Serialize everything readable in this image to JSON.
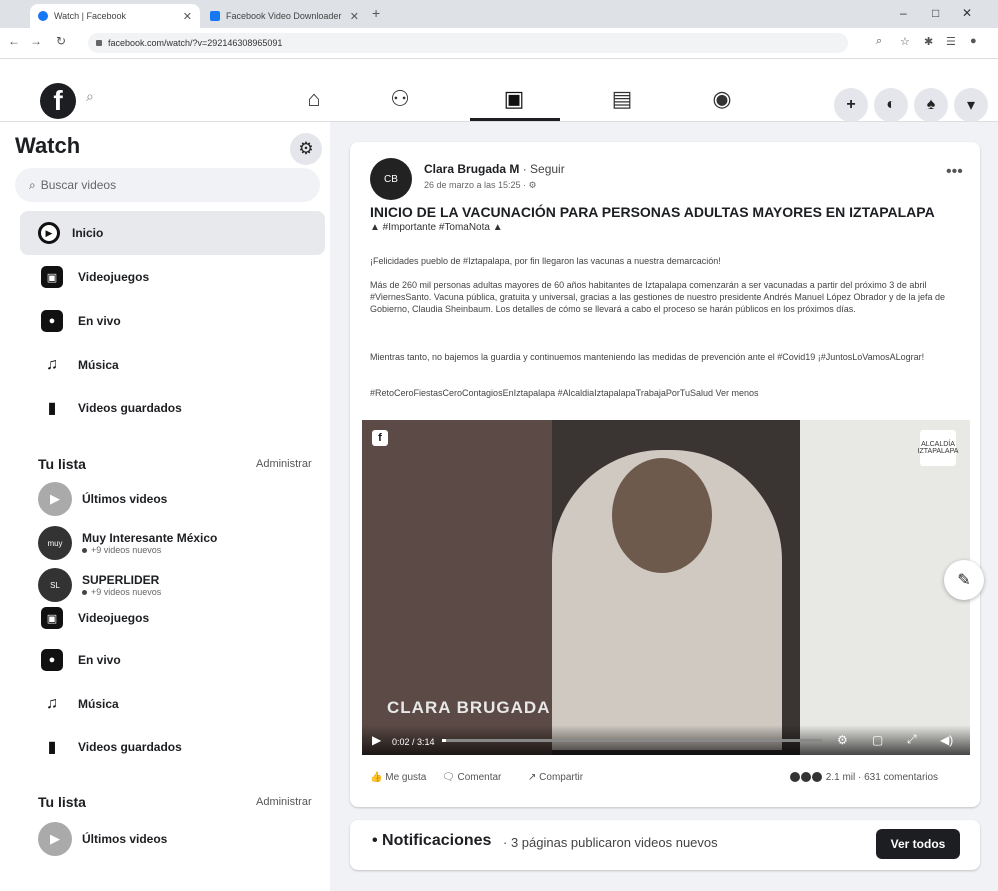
{
  "browser": {
    "tabs": [
      {
        "title": "Watch | Facebook",
        "active": true
      },
      {
        "title": "Facebook Video Downloader",
        "active": false
      }
    ],
    "url": "facebook.com/watch/?v=292146308965091",
    "new_tab": "+",
    "window_controls": [
      "–",
      "□",
      "✕"
    ]
  },
  "fb_nav": {
    "logo": "f",
    "search_icon": "magnifier",
    "icons": [
      "home-icon",
      "friends-icon",
      "watch-icon",
      "marketplace-icon",
      "groups-icon"
    ],
    "right_buttons": [
      "+",
      "messenger-icon",
      "notifications-icon",
      "dropdown-icon"
    ]
  },
  "sidebar": {
    "title": "Watch",
    "search_placeholder": "Buscar videos",
    "items": [
      {
        "label": "Inicio",
        "icon": "play-icon"
      },
      {
        "label": "Videojuegos",
        "icon": "gaming-icon"
      },
      {
        "label": "En vivo",
        "icon": "live-icon"
      },
      {
        "label": "Música",
        "icon": "music-icon"
      },
      {
        "label": "Videos guardados",
        "icon": "bookmark-icon"
      }
    ],
    "list_title": "Tu lista",
    "list_action": "Administrar",
    "list_items": [
      {
        "name": "Últimos videos",
        "sub": ""
      },
      {
        "name": "Muy Interesante México",
        "sub": "+9 videos nuevos"
      },
      {
        "name": "SUPERLIDER",
        "sub": "+9 videos nuevos"
      }
    ],
    "items2": [
      {
        "label": "Videojuegos"
      },
      {
        "label": "En vivo"
      },
      {
        "label": "Música"
      },
      {
        "label": "Videos guardados"
      }
    ],
    "list2_title": "Tu lista",
    "list2_action": "Administrar",
    "list2_items": [
      {
        "name": "Últimos videos"
      }
    ]
  },
  "post": {
    "author": "Clara Brugada M",
    "follow": " · Seguir",
    "date": "26 de marzo a las 15:25 · ⚙",
    "title": "INICIO DE LA VACUNACIÓN PARA PERSONAS ADULTAS MAYORES EN IZTAPALAPA",
    "tagline": "▲ #Importante #TomaNota ▲",
    "paragraphs": [
      "¡Felicidades pueblo de #Iztapalapa, por fin llegaron las vacunas a nuestra demarcación!",
      "Más de 260 mil personas adultas mayores de 60 años habitantes de Iztapalapa comenzarán a ser vacunadas a partir del próximo 3 de abril #ViernesSanto. Vacuna pública, gratuita y universal, gracias a las gestiones de nuestro presidente Andrés Manuel López Obrador y de la jefa de Gobierno, Claudia Sheinbaum. Los detalles de cómo se llevará a cabo el proceso se harán públicos en los próximos días.",
      "Mientras tanto, no bajemos la guardia y continuemos manteniendo las medidas de prevención ante el #Covid19 ¡#JuntosLoVamosALograr!",
      "#RetoCeroFiestasCeroContagiosEnIztapalapa #AlcaldiaIztapalapaTrabajaPorTuSalud Ver menos"
    ],
    "video": {
      "lower_third": "CLARA BRUGADA",
      "time": "0:02 / 3:14",
      "progress": 0.01,
      "badge": "ALCALDÍA IZTAPALAPA",
      "logo": "f"
    },
    "actions": {
      "like": "Me gusta",
      "comment": "Comentar",
      "share": "Compartir",
      "stats": "2.1 mil · 631 comentarios"
    }
  },
  "notifications": {
    "title": "• Notificaciones",
    "sub": "· 3 páginas publicaron videos nuevos",
    "button": "Ver todos"
  }
}
